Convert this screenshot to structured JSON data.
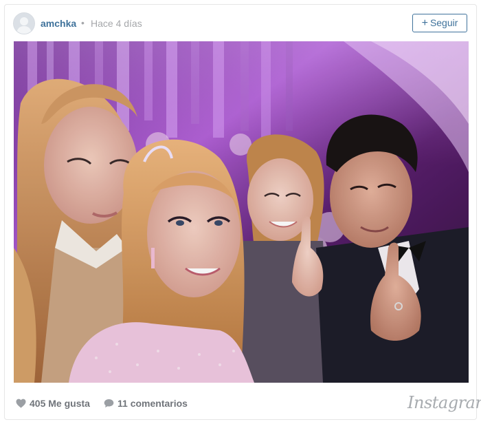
{
  "post": {
    "username": "amchka",
    "separator": "•",
    "time": "Hace 4 días",
    "follow_label": "Seguir",
    "follow_plus": "+"
  },
  "photo": {
    "description_icon": "group-selfie-photo"
  },
  "stats": {
    "likes": "405 Me gusta",
    "comments": "11 comentarios"
  },
  "brand": {
    "logo_text": "Instagram"
  },
  "colors": {
    "link_blue": "#3f729b",
    "muted_gray": "#a5a7aa",
    "stats_gray": "#70747a"
  },
  "icons": {
    "avatar": "default-avatar-icon",
    "like": "heart-icon",
    "comment": "speech-bubble-icon"
  }
}
